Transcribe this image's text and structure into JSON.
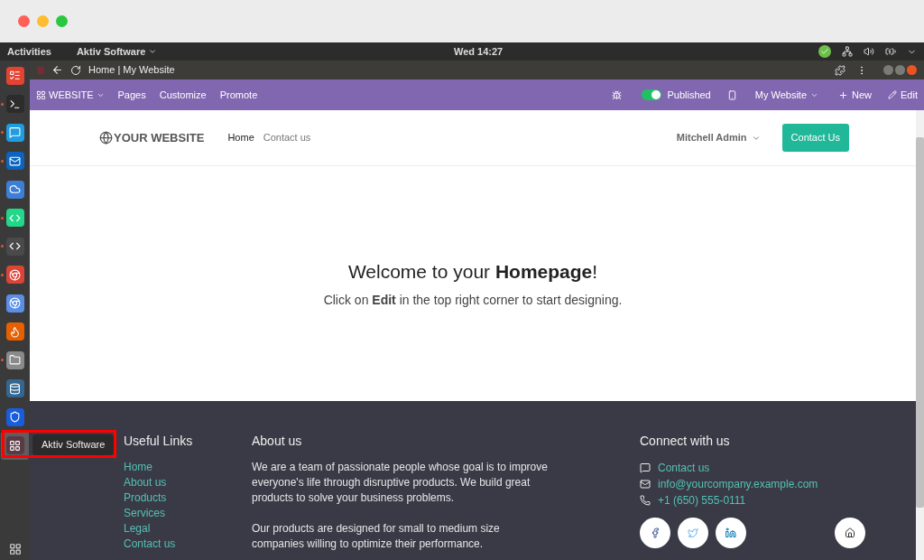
{
  "top_bar": {
    "activities": "Activities",
    "app_menu": "Aktiv Software",
    "clock": "Wed 14:27"
  },
  "dock": {
    "items": [
      {
        "kind": "tasks",
        "running": false,
        "selected": false
      },
      {
        "kind": "terminal",
        "running": true,
        "selected": false
      },
      {
        "kind": "chat",
        "running": true,
        "selected": false
      },
      {
        "kind": "mail",
        "running": true,
        "selected": false
      },
      {
        "kind": "cloud",
        "running": false,
        "selected": false
      },
      {
        "kind": "ide",
        "running": true,
        "selected": false
      },
      {
        "kind": "editor",
        "running": true,
        "selected": false
      },
      {
        "kind": "browser",
        "running": true,
        "selected": false
      },
      {
        "kind": "browser2",
        "running": false,
        "selected": false
      },
      {
        "kind": "fox",
        "running": false,
        "selected": false
      },
      {
        "kind": "files",
        "running": true,
        "selected": false
      },
      {
        "kind": "database",
        "running": false,
        "selected": false
      },
      {
        "kind": "shield",
        "running": false,
        "selected": false
      },
      {
        "kind": "dots",
        "running": false,
        "selected": true
      }
    ],
    "tooltip": "Aktiv Software"
  },
  "browser": {
    "title": "Home | My Website"
  },
  "odoo_bar": {
    "app": "WEBSITE",
    "menu": [
      "Pages",
      "Customize",
      "Promote"
    ],
    "published": {
      "label": "Published",
      "on": true
    },
    "website": "My Website",
    "new": "New",
    "edit": "Edit"
  },
  "site_header": {
    "logo": "YOUR WEBSITE",
    "nav": [
      {
        "label": "Home",
        "selected": true
      },
      {
        "label": "Contact us",
        "selected": false
      }
    ],
    "user": "Mitchell Admin",
    "cta": "Contact Us"
  },
  "hero": {
    "title": "Welcome to your **Homepage**!",
    "subtitle": "Click on **Edit** in the top right corner to start designing."
  },
  "footer": {
    "links": {
      "heading": "Useful Links",
      "items": [
        "Home",
        "About us",
        "Products",
        "Services",
        "Legal",
        "Contact us"
      ]
    },
    "about": {
      "heading": "About us",
      "paragraphs": [
        "We are a team of passionate people whose goal is to improve everyone's life through disruptive products. We build great products to solve your business problems.",
        "Our products are designed for small to medium size companies willing to optimize their performance."
      ]
    },
    "connect": {
      "heading": "Connect with us",
      "items": [
        {
          "kind": "chat",
          "text": "Contact us"
        },
        {
          "kind": "mail",
          "text": "info@yourcompany.example.com"
        },
        {
          "kind": "phone",
          "text": "+1 (650) 555-0111"
        }
      ],
      "socials": [
        {
          "kind": "facebook"
        },
        {
          "kind": "twitter"
        },
        {
          "kind": "linkedin"
        },
        {
          "kind": "home"
        }
      ]
    }
  }
}
